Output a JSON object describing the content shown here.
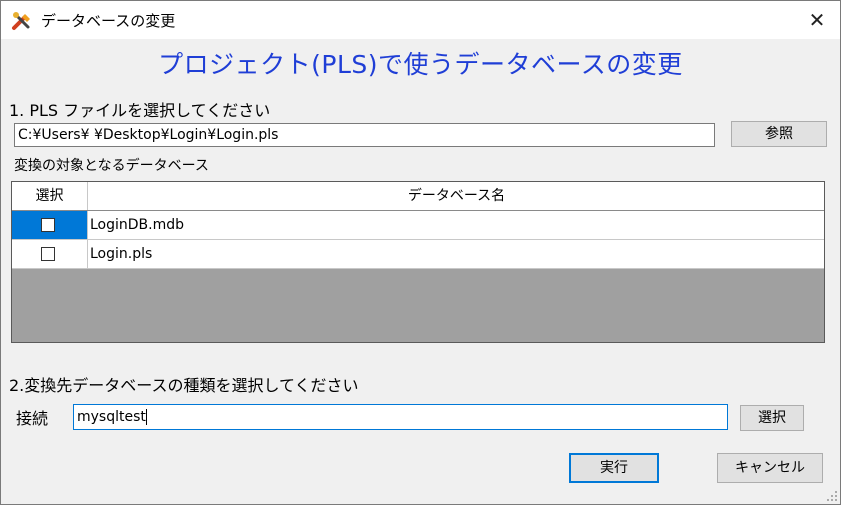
{
  "window": {
    "title": "データベースの変更",
    "close_glyph": "✕"
  },
  "heading": "プロジェクト(PLS)で使うデータベースの変更",
  "step1": {
    "label": "1. PLS ファイルを選択してください",
    "file_path": "C:¥Users¥        ¥Desktop¥Login¥Login.pls",
    "browse_label": "参照"
  },
  "target_label": "変換の対象となるデータベース",
  "grid": {
    "columns": [
      "選択",
      "データベース名"
    ],
    "rows": [
      {
        "checked": false,
        "name": "LoginDB.mdb",
        "selected": true
      },
      {
        "checked": false,
        "name": "Login.pls",
        "selected": false
      }
    ]
  },
  "step2": {
    "label": "2.変換先データベースの種類を選択してください",
    "connection_label": "接続",
    "connection_value": "mysqltest",
    "select_label": "選択"
  },
  "buttons": {
    "run": "実行",
    "cancel": "キャンセル"
  },
  "icons": {
    "app": "tools-icon",
    "close": "close-icon",
    "grip": "resize-grip-icon"
  },
  "colors": {
    "heading": "#1f3ed6",
    "selection": "#0078d7",
    "grid_empty": "#a0a0a0"
  }
}
